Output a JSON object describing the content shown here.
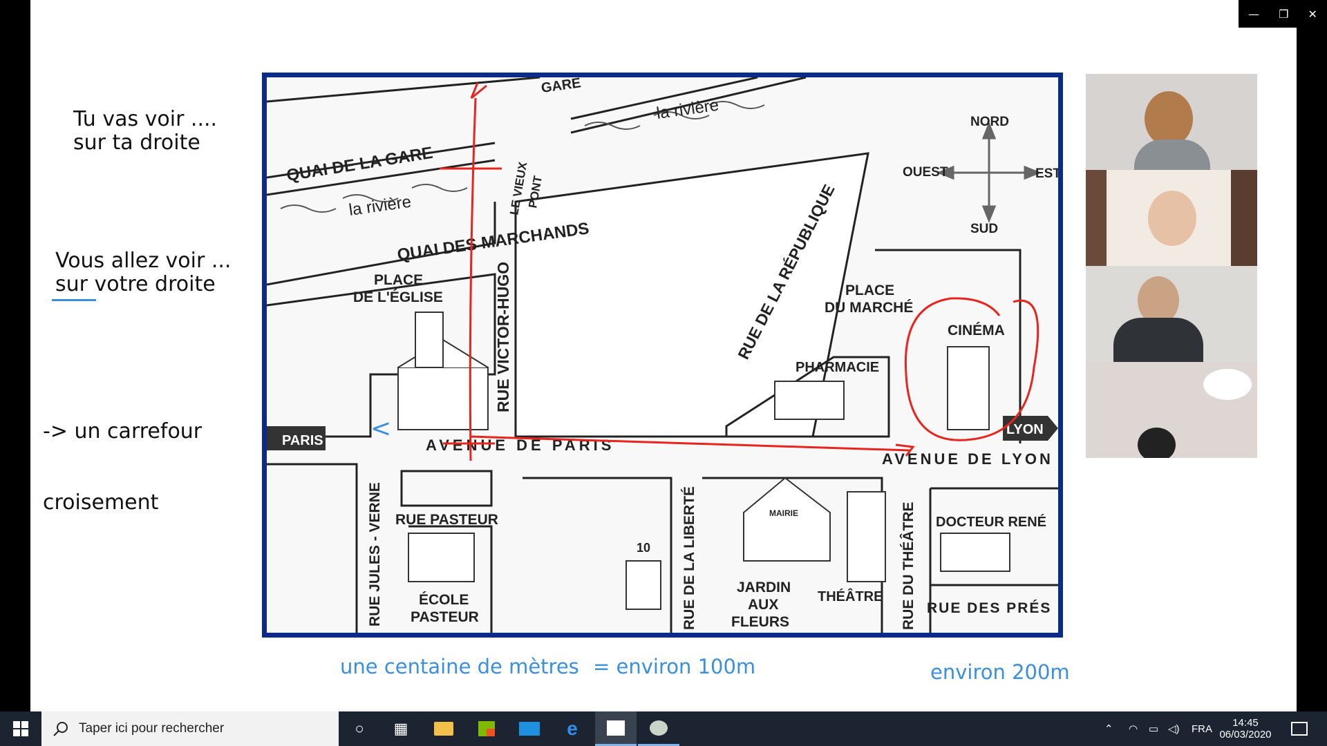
{
  "notes": {
    "line1": "Tu vas voir ....",
    "line2": "sur ta droite",
    "line3": "Vous allez voir ...",
    "line4": "sur votre droite",
    "line5": "-> un carrefour",
    "line6": "croisement",
    "blue1": "une centaine de mètres",
    "blue2": "= environ 100m",
    "blue3": "environ 200m"
  },
  "map": {
    "quai_gare": "QUAI DE LA GARE",
    "gare": "GARE",
    "riviere": "la rivière",
    "vieux_pont1": "LE VIEUX",
    "vieux_pont2": "PONT",
    "quai_marchands": "QUAI DES MARCHANDS",
    "nord": "NORD",
    "sud": "SUD",
    "ouest": "OUEST",
    "est": "EST",
    "rue_republique": "RUE DE LA RÉPUBLIQUE",
    "place_eglise1": "PLACE",
    "place_eglise2": "DE L'ÉGLISE",
    "rue_victor_hugo": "RUE VICTOR-HUGO",
    "place_marche1": "PLACE",
    "place_marche2": "DU MARCHÉ",
    "cinema": "CINÉMA",
    "pharmacie": "PHARMACIE",
    "paris": "PARIS",
    "lyon": "LYON",
    "avenue_paris": "AVENUE DE PARIS",
    "avenue_lyon": "AVENUE DE LYON",
    "rue_jules_verne": "RUE JULES - VERNE",
    "rue_pasteur": "RUE PASTEUR",
    "ecole1": "ÉCOLE",
    "ecole2": "PASTEUR",
    "num10": "10",
    "rue_liberte": "RUE DE LA LIBERTÉ",
    "mairie": "MAIRIE",
    "jardin1": "JARDIN",
    "jardin2": "AUX",
    "jardin3": "FLEURS",
    "theatre": "THÉÂTRE",
    "rue_theatre": "RUE DU THÉÂTRE",
    "docteur": "DOCTEUR RENÉ",
    "rue_pres": "RUE DES PRÉS"
  },
  "window_controls": {
    "minimize": "—",
    "restore": "❐",
    "close": "✕"
  },
  "taskbar": {
    "search_placeholder": "Taper ici pour rechercher",
    "language": "FRA",
    "time": "14:45",
    "date": "06/03/2020"
  },
  "colors": {
    "map_border": "#0c2a8a",
    "annotation_red": "#e8241e",
    "note_blue": "#3a8fe0",
    "taskbar": "#1b2430"
  }
}
